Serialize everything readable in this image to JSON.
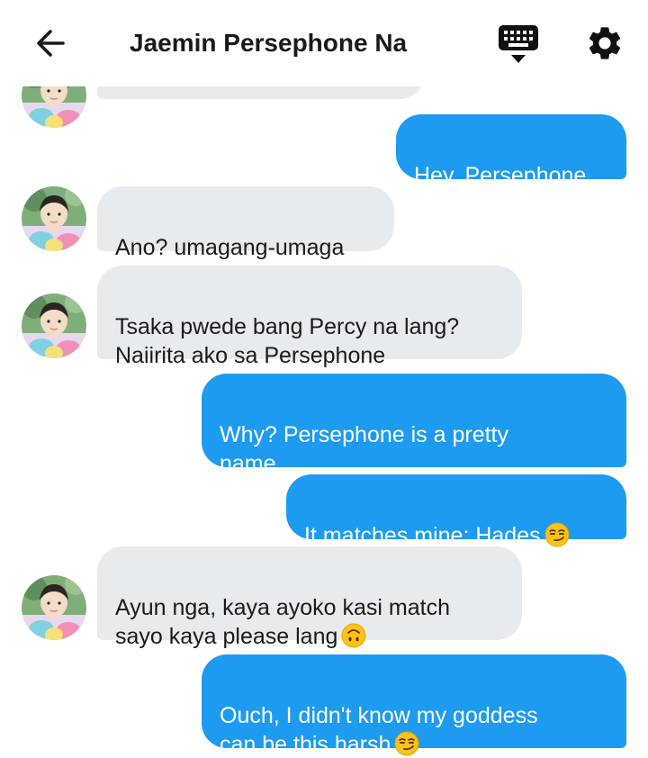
{
  "header": {
    "back_icon": "arrow-left-icon",
    "title": "Jaemin Persephone Na",
    "keyboard_icon": "keyboard-icon",
    "settings_icon": "gear-icon"
  },
  "messages": [
    {
      "sender": "them",
      "text": ""
    },
    {
      "sender": "me",
      "text": "Hey, Persephone."
    },
    {
      "sender": "them",
      "text": "Ano? umagang-umaga"
    },
    {
      "sender": "them",
      "text": "Tsaka pwede bang Percy na lang?\nNaiirita ako sa Persephone"
    },
    {
      "sender": "me",
      "text": "Why? Persephone is a pretty\nname."
    },
    {
      "sender": "me",
      "text": "It matches mine: Hades",
      "emoji": "smirking-face-emoji"
    },
    {
      "sender": "them",
      "text": "Ayun nga, kaya ayoko kasi match\nsayo kaya please lang",
      "emoji": "upside-down-face-emoji"
    },
    {
      "sender": "me",
      "text": "Ouch, I didn't know my goddess\ncan be this harsh",
      "emoji": "smirking-face-emoji"
    }
  ],
  "colors": {
    "sent_bubble": "#1d9bf0",
    "received_bubble": "#e8ebee",
    "text_dark": "#1a1a1a"
  }
}
